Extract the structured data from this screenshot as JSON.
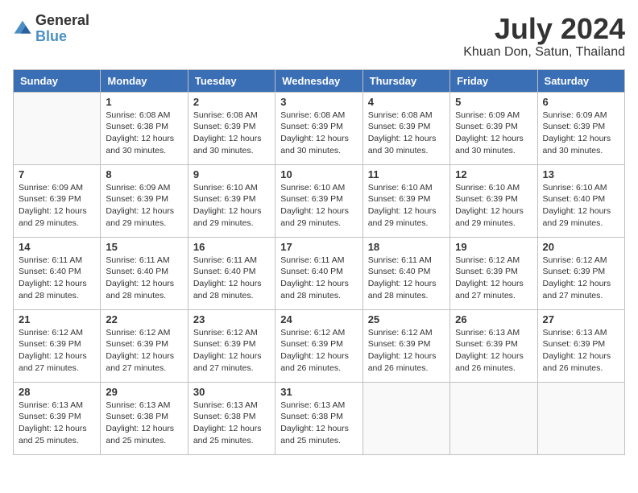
{
  "logo": {
    "line1": "General",
    "line2": "Blue"
  },
  "title": "July 2024",
  "subtitle": "Khuan Don, Satun, Thailand",
  "headers": [
    "Sunday",
    "Monday",
    "Tuesday",
    "Wednesday",
    "Thursday",
    "Friday",
    "Saturday"
  ],
  "weeks": [
    [
      {
        "day": "",
        "info": ""
      },
      {
        "day": "1",
        "info": "Sunrise: 6:08 AM\nSunset: 6:38 PM\nDaylight: 12 hours\nand 30 minutes."
      },
      {
        "day": "2",
        "info": "Sunrise: 6:08 AM\nSunset: 6:39 PM\nDaylight: 12 hours\nand 30 minutes."
      },
      {
        "day": "3",
        "info": "Sunrise: 6:08 AM\nSunset: 6:39 PM\nDaylight: 12 hours\nand 30 minutes."
      },
      {
        "day": "4",
        "info": "Sunrise: 6:08 AM\nSunset: 6:39 PM\nDaylight: 12 hours\nand 30 minutes."
      },
      {
        "day": "5",
        "info": "Sunrise: 6:09 AM\nSunset: 6:39 PM\nDaylight: 12 hours\nand 30 minutes."
      },
      {
        "day": "6",
        "info": "Sunrise: 6:09 AM\nSunset: 6:39 PM\nDaylight: 12 hours\nand 30 minutes."
      }
    ],
    [
      {
        "day": "7",
        "info": "Sunrise: 6:09 AM\nSunset: 6:39 PM\nDaylight: 12 hours\nand 29 minutes."
      },
      {
        "day": "8",
        "info": "Sunrise: 6:09 AM\nSunset: 6:39 PM\nDaylight: 12 hours\nand 29 minutes."
      },
      {
        "day": "9",
        "info": "Sunrise: 6:10 AM\nSunset: 6:39 PM\nDaylight: 12 hours\nand 29 minutes."
      },
      {
        "day": "10",
        "info": "Sunrise: 6:10 AM\nSunset: 6:39 PM\nDaylight: 12 hours\nand 29 minutes."
      },
      {
        "day": "11",
        "info": "Sunrise: 6:10 AM\nSunset: 6:39 PM\nDaylight: 12 hours\nand 29 minutes."
      },
      {
        "day": "12",
        "info": "Sunrise: 6:10 AM\nSunset: 6:39 PM\nDaylight: 12 hours\nand 29 minutes."
      },
      {
        "day": "13",
        "info": "Sunrise: 6:10 AM\nSunset: 6:40 PM\nDaylight: 12 hours\nand 29 minutes."
      }
    ],
    [
      {
        "day": "14",
        "info": "Sunrise: 6:11 AM\nSunset: 6:40 PM\nDaylight: 12 hours\nand 28 minutes."
      },
      {
        "day": "15",
        "info": "Sunrise: 6:11 AM\nSunset: 6:40 PM\nDaylight: 12 hours\nand 28 minutes."
      },
      {
        "day": "16",
        "info": "Sunrise: 6:11 AM\nSunset: 6:40 PM\nDaylight: 12 hours\nand 28 minutes."
      },
      {
        "day": "17",
        "info": "Sunrise: 6:11 AM\nSunset: 6:40 PM\nDaylight: 12 hours\nand 28 minutes."
      },
      {
        "day": "18",
        "info": "Sunrise: 6:11 AM\nSunset: 6:40 PM\nDaylight: 12 hours\nand 28 minutes."
      },
      {
        "day": "19",
        "info": "Sunrise: 6:12 AM\nSunset: 6:39 PM\nDaylight: 12 hours\nand 27 minutes."
      },
      {
        "day": "20",
        "info": "Sunrise: 6:12 AM\nSunset: 6:39 PM\nDaylight: 12 hours\nand 27 minutes."
      }
    ],
    [
      {
        "day": "21",
        "info": "Sunrise: 6:12 AM\nSunset: 6:39 PM\nDaylight: 12 hours\nand 27 minutes."
      },
      {
        "day": "22",
        "info": "Sunrise: 6:12 AM\nSunset: 6:39 PM\nDaylight: 12 hours\nand 27 minutes."
      },
      {
        "day": "23",
        "info": "Sunrise: 6:12 AM\nSunset: 6:39 PM\nDaylight: 12 hours\nand 27 minutes."
      },
      {
        "day": "24",
        "info": "Sunrise: 6:12 AM\nSunset: 6:39 PM\nDaylight: 12 hours\nand 26 minutes."
      },
      {
        "day": "25",
        "info": "Sunrise: 6:12 AM\nSunset: 6:39 PM\nDaylight: 12 hours\nand 26 minutes."
      },
      {
        "day": "26",
        "info": "Sunrise: 6:13 AM\nSunset: 6:39 PM\nDaylight: 12 hours\nand 26 minutes."
      },
      {
        "day": "27",
        "info": "Sunrise: 6:13 AM\nSunset: 6:39 PM\nDaylight: 12 hours\nand 26 minutes."
      }
    ],
    [
      {
        "day": "28",
        "info": "Sunrise: 6:13 AM\nSunset: 6:39 PM\nDaylight: 12 hours\nand 25 minutes."
      },
      {
        "day": "29",
        "info": "Sunrise: 6:13 AM\nSunset: 6:38 PM\nDaylight: 12 hours\nand 25 minutes."
      },
      {
        "day": "30",
        "info": "Sunrise: 6:13 AM\nSunset: 6:38 PM\nDaylight: 12 hours\nand 25 minutes."
      },
      {
        "day": "31",
        "info": "Sunrise: 6:13 AM\nSunset: 6:38 PM\nDaylight: 12 hours\nand 25 minutes."
      },
      {
        "day": "",
        "info": ""
      },
      {
        "day": "",
        "info": ""
      },
      {
        "day": "",
        "info": ""
      }
    ]
  ]
}
